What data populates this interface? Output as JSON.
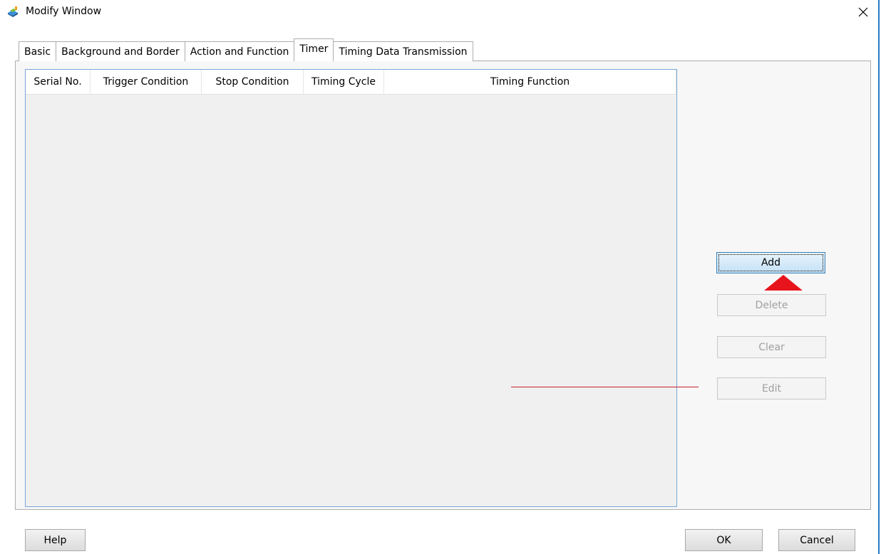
{
  "window": {
    "title": "Modify Window",
    "close_icon": "close-icon"
  },
  "tabs": [
    {
      "label": "Basic",
      "active": false
    },
    {
      "label": "Background and Border",
      "active": false
    },
    {
      "label": "Action and Function",
      "active": false
    },
    {
      "label": "Timer",
      "active": true
    },
    {
      "label": "Timing Data Transmission",
      "active": false
    }
  ],
  "table": {
    "columns": [
      "Serial No.",
      "Trigger Condition",
      "Stop Condition",
      "Timing Cycle",
      "Timing Function"
    ],
    "rows": []
  },
  "actions": {
    "add": "Add",
    "delete": "Delete",
    "clear": "Clear",
    "edit": "Edit"
  },
  "footer": {
    "help": "Help",
    "ok": "OK",
    "cancel": "Cancel"
  },
  "colors": {
    "accent": "#3c7fb1",
    "marker": "#e8141c"
  }
}
